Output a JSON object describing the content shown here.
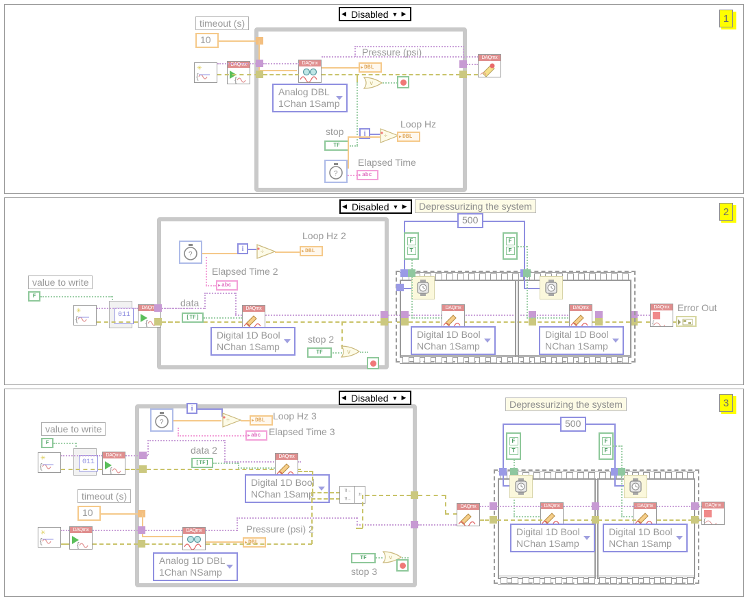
{
  "app": {
    "title": "LabVIEW Block Diagram",
    "type": "labview-block-diagram"
  },
  "panels": [
    {
      "id": "panel-1",
      "badge": "1",
      "disable_structure": {
        "label": "Disabled",
        "left_arrow": "◀",
        "right_arrow": "▶",
        "dropdown": "▼"
      },
      "labels": {
        "timeout": "timeout (s)",
        "timeout_value": "10",
        "pressure": "Pressure (psi)",
        "loop_hz": "Loop Hz",
        "stop": "stop",
        "elapsed_time": "Elapsed Time"
      },
      "enums": [
        {
          "line1": "Analog DBL",
          "line2": "1Chan 1Samp"
        }
      ],
      "terminals": {
        "dbl": "DBL",
        "str": "abc",
        "bool": "TF",
        "iteration": "i"
      },
      "nodes": [
        {
          "name": "daqmx-create-virtual-channel"
        },
        {
          "name": "daqmx-start-task"
        },
        {
          "name": "daqmx-read"
        },
        {
          "name": "daqmx-clear-task"
        },
        {
          "name": "elapsed-time-express-vi"
        },
        {
          "name": "divide"
        },
        {
          "name": "or-gate"
        },
        {
          "name": "stop-button"
        }
      ]
    },
    {
      "id": "panel-2",
      "badge": "2",
      "disable_structure": {
        "label": "Disabled",
        "left_arrow": "◀",
        "right_arrow": "▶",
        "dropdown": "▼"
      },
      "free_label": "Depressurizing the system",
      "labels": {
        "value_to_write": "value to write",
        "loop_hz_2": "Loop Hz 2",
        "elapsed_time_2": "Elapsed Time 2",
        "data": "data",
        "stop_2": "stop 2",
        "error_out": "Error Out",
        "wait_value": "500"
      },
      "enums": [
        {
          "line1": "Digital 1D Bool",
          "line2": "NChan 1Samp"
        },
        {
          "line1": "Digital 1D Bool",
          "line2": "NChan 1Samp"
        },
        {
          "line1": "Digital 1D Bool",
          "line2": "NChan 1Samp"
        }
      ],
      "bool_constants": [
        {
          "values": [
            "F",
            "T"
          ]
        },
        {
          "values": [
            "F",
            "F"
          ]
        }
      ],
      "terminals": {
        "dbl": "DBL",
        "str": "abc",
        "bool": "F",
        "bool_array": "[TF]",
        "bool_stop": "TF",
        "iteration": "i",
        "array_const": "011"
      }
    },
    {
      "id": "panel-3",
      "badge": "3",
      "disable_structure": {
        "label": "Disabled",
        "left_arrow": "◀",
        "right_arrow": "▶",
        "dropdown": "▼"
      },
      "free_label": "Depressurizing the system",
      "labels": {
        "value_to_write": "value to write",
        "timeout": "timeout (s)",
        "timeout_value": "10",
        "loop_hz_3": "Loop Hz 3",
        "elapsed_time_3": "Elapsed Time 3",
        "data_2": "data 2",
        "pressure_2": "Pressure (psi) 2",
        "stop_3": "stop 3",
        "wait_value": "500"
      },
      "enums": [
        {
          "line1": "Digital 1D Bool",
          "line2": "NChan 1Samp"
        },
        {
          "line1": "Analog 1D DBL",
          "line2": "1Chan NSamp"
        },
        {
          "line1": "Digital 1D Bool",
          "line2": "NChan 1Samp"
        },
        {
          "line1": "Digital 1D Bool",
          "line2": "NChan 1Samp"
        }
      ],
      "bool_constants": [
        {
          "values": [
            "F",
            "T"
          ]
        },
        {
          "values": [
            "F",
            "F"
          ]
        }
      ],
      "terminals": {
        "dbl": "DBL",
        "str": "abc",
        "bool": "F",
        "bool_array": "[TF]",
        "bool_stop": "TF",
        "iteration": "i",
        "array_const": "011"
      }
    }
  ],
  "colors": {
    "error_wire": "#c9c36a",
    "task_wire": "#c9a0d8",
    "numeric_wire": "#f5c98a",
    "boolean_wire": "#9ecfa8",
    "string_wire": "#f3a0d8",
    "structure_border": "#c9c9c9",
    "badge_bg": "#ffff00"
  }
}
